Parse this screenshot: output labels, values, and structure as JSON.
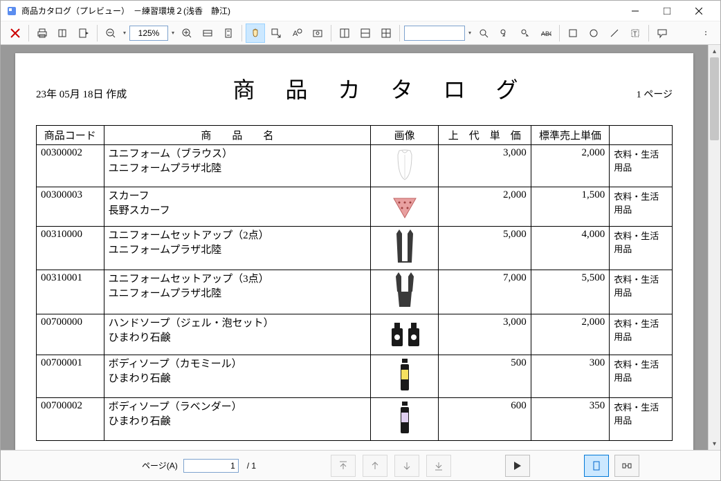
{
  "window": {
    "title": "商品カタログ（プレビュー）　－練習環境２(浅香　静江)"
  },
  "toolbar": {
    "zoom": "125%"
  },
  "doc": {
    "date": "23年 05月 18日 作成",
    "title": "商 品 カ タ ロ グ",
    "page_label": "1 ページ"
  },
  "headers": {
    "code": "商品コード",
    "name": "商　　品　　名",
    "image": "画像",
    "price": "上　代　単　価",
    "price2": "標準売上単価",
    "cat": ""
  },
  "rows": [
    {
      "code": "00300002",
      "name": "ユニフォーム（ブラウス）",
      "supplier": "ユニフォームプラザ北陸",
      "price": "3,000",
      "price2": "2,000",
      "cat": "衣料・生活用品",
      "icon": "blouse"
    },
    {
      "code": "00300003",
      "name": "スカーフ",
      "supplier": "長野スカーフ",
      "price": "2,000",
      "price2": "1,500",
      "cat": "衣料・生活用品",
      "icon": "scarf"
    },
    {
      "code": "00310000",
      "name": "ユニフォームセットアップ（2点）",
      "supplier": "ユニフォームプラザ北陸",
      "price": "5,000",
      "price2": "4,000",
      "cat": "衣料・生活用品",
      "icon": "vest"
    },
    {
      "code": "00310001",
      "name": "ユニフォームセットアップ（3点）",
      "supplier": "ユニフォームプラザ北陸",
      "price": "7,000",
      "price2": "5,500",
      "cat": "衣料・生活用品",
      "icon": "suit"
    },
    {
      "code": "00700000",
      "name": "ハンドソープ（ジェル・泡セット）",
      "supplier": "ひまわり石鹸",
      "price": "3,000",
      "price2": "2,000",
      "cat": "衣料・生活用品",
      "icon": "soap2"
    },
    {
      "code": "00700001",
      "name": "ボディソープ（カモミール）",
      "supplier": "ひまわり石鹸",
      "price": "500",
      "price2": "300",
      "cat": "衣料・生活用品",
      "icon": "bottle-y"
    },
    {
      "code": "00700002",
      "name": "ボディソープ（ラベンダー）",
      "supplier": "ひまわり石鹸",
      "price": "600",
      "price2": "350",
      "cat": "衣料・生活用品",
      "icon": "bottle-p"
    }
  ],
  "statusbar": {
    "page_label": "ページ(A)",
    "page": "1",
    "total": "/  1"
  }
}
